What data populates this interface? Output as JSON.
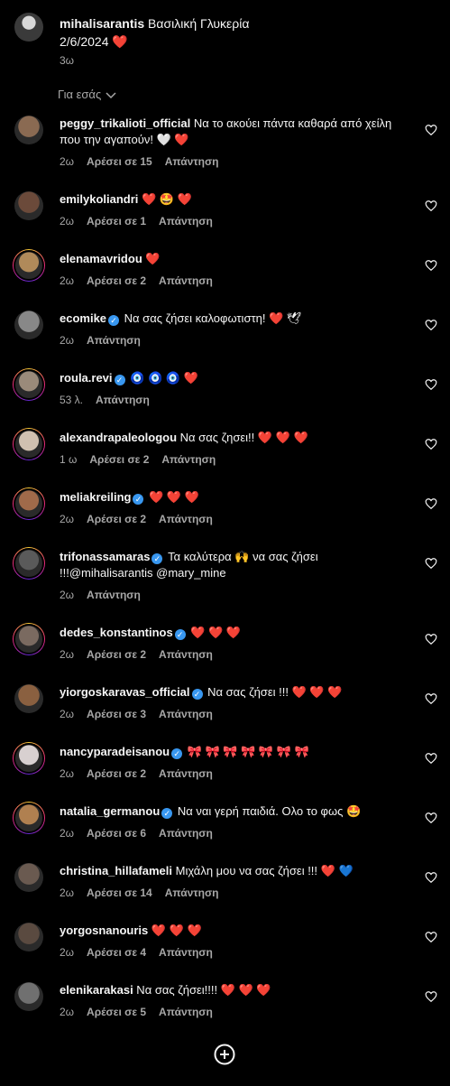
{
  "caption": {
    "username": "mihalisarantis",
    "text": " Βασιλική Γλυκερία",
    "line2": "2/6/2024 ❤️",
    "time": "3ω"
  },
  "for_you": "Για εσάς",
  "comments": [
    {
      "username": "peggy_trikalioti_official",
      "verified": false,
      "text": " Να το ακούει πάντα καθαρά από χείλη που την αγαπούν! 🤍 ❤️",
      "time": "2ω",
      "likes": "Αρέσει σε 15",
      "reply": "Απάντηση",
      "ring": false,
      "color": "#8a6a52"
    },
    {
      "username": "emilykoliandri",
      "verified": false,
      "text": " ❤️ 🤩 ❤️",
      "time": "2ω",
      "likes": "Αρέσει σε 1",
      "reply": "Απάντηση",
      "ring": false,
      "color": "#6b4a3a"
    },
    {
      "username": "elenamavridou",
      "verified": false,
      "text": " ❤️",
      "time": "2ω",
      "likes": "Αρέσει σε 2",
      "reply": "Απάντηση",
      "ring": true,
      "color": "#b08a5a"
    },
    {
      "username": "ecomike",
      "verified": true,
      "text": " Να σας ζήσει καλοφωτιστη! ❤️ 🕊",
      "time": "2ω",
      "likes": "",
      "reply": "Απάντηση",
      "ring": false,
      "color": "#888888"
    },
    {
      "username": "roula.revi",
      "verified": true,
      "text": " 🧿 🧿 🧿 ❤️",
      "time": "53 λ.",
      "likes": "",
      "reply": "Απάντηση",
      "ring": true,
      "color": "#9a8a7a"
    },
    {
      "username": "alexandrapaleologou",
      "verified": false,
      "text": " Να σας ζησει!! ❤️ ❤️ ❤️",
      "time": "1 ω",
      "likes": "Αρέσει σε 2",
      "reply": "Απάντηση",
      "ring": true,
      "color": "#d0c0b0"
    },
    {
      "username": "meliakreiling",
      "verified": true,
      "text": " ❤️ ❤️ ❤️",
      "time": "2ω",
      "likes": "Αρέσει σε 2",
      "reply": "Απάντηση",
      "ring": true,
      "color": "#a06a4a"
    },
    {
      "username": "trifonassamaras",
      "verified": true,
      "text": " Τα καλύτερα 🙌 να σας ζήσει !!!@mihalisarantis @mary_mine",
      "time": "2ω",
      "likes": "",
      "reply": "Απάντηση",
      "ring": true,
      "color": "#5a5a5a"
    },
    {
      "username": "dedes_konstantinos",
      "verified": true,
      "text": " ❤️ ❤️ ❤️",
      "time": "2ω",
      "likes": "Αρέσει σε 2",
      "reply": "Απάντηση",
      "ring": true,
      "color": "#7a6a60"
    },
    {
      "username": "yiorgoskaravas_official",
      "verified": true,
      "text": " Να σας ζήσει !!! ❤️ ❤️ ❤️",
      "time": "2ω",
      "likes": "Αρέσει σε 3",
      "reply": "Απάντηση",
      "ring": false,
      "color": "#8a6040"
    },
    {
      "username": "nancyparadeisanou",
      "verified": true,
      "text": " 🎀 🎀 🎀 🎀 🎀 🎀 🎀",
      "time": "2ω",
      "likes": "Αρέσει σε 2",
      "reply": "Απάντηση",
      "ring": true,
      "color": "#d8d0d0"
    },
    {
      "username": "natalia_germanou",
      "verified": true,
      "text": " Να ναι γερή παιδιά. Ολο το φως 🤩",
      "time": "2ω",
      "likes": "Αρέσει σε 6",
      "reply": "Απάντηση",
      "ring": true,
      "color": "#b08050"
    },
    {
      "username": "christina_hillafameli",
      "verified": false,
      "text": " Μιχάλη μου να σας ζήσει !!! ❤️ 💙",
      "time": "2ω",
      "likes": "Αρέσει σε 14",
      "reply": "Απάντηση",
      "ring": false,
      "color": "#6a5a50"
    },
    {
      "username": "yorgosnanouris",
      "verified": false,
      "text": " ❤️ ❤️ ❤️",
      "time": "2ω",
      "likes": "Αρέσει σε 4",
      "reply": "Απάντηση",
      "ring": false,
      "color": "#5a4a40"
    },
    {
      "username": "elenikarakasi",
      "verified": false,
      "text": " Να σας ζήσει!!!! ❤️ ❤️ ❤️",
      "time": "2ω",
      "likes": "Αρέσει σε 5",
      "reply": "Απάντηση",
      "ring": false,
      "color": "#707070"
    }
  ]
}
